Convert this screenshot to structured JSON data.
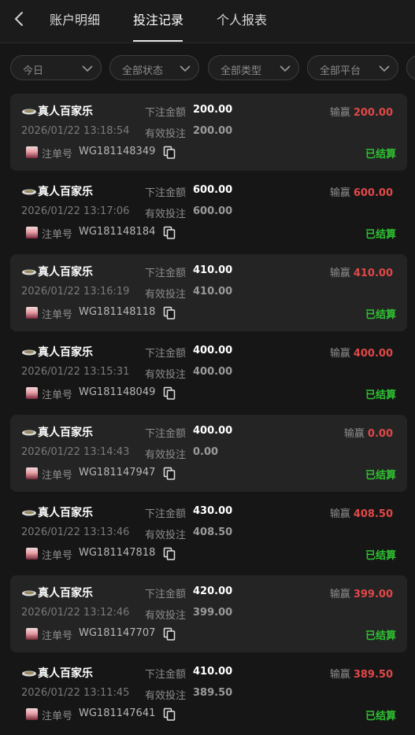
{
  "header": {
    "tabs": [
      {
        "label": "账户明细",
        "active": false
      },
      {
        "label": "投注记录",
        "active": true
      },
      {
        "label": "个人报表",
        "active": false
      }
    ]
  },
  "filters": [
    {
      "label": "今日"
    },
    {
      "label": "全部状态"
    },
    {
      "label": "全部类型"
    },
    {
      "label": "全部平台"
    }
  ],
  "labels": {
    "bet_amount": "下注金额",
    "valid_bet": "有效投注",
    "win_loss": "输赢",
    "order_no": "注单号"
  },
  "colors": {
    "win": "#e04848",
    "status": "#2fc032"
  },
  "records": [
    {
      "game": "真人百家乐",
      "bet": "200.00",
      "valid": "200.00",
      "winloss": "200.00",
      "time": "2026/01/22 13:18:54",
      "order": "WG181148349",
      "status": "已结算"
    },
    {
      "game": "真人百家乐",
      "bet": "600.00",
      "valid": "600.00",
      "winloss": "600.00",
      "time": "2026/01/22 13:17:06",
      "order": "WG181148184",
      "status": "已结算"
    },
    {
      "game": "真人百家乐",
      "bet": "410.00",
      "valid": "410.00",
      "winloss": "410.00",
      "time": "2026/01/22 13:16:19",
      "order": "WG181148118",
      "status": "已结算"
    },
    {
      "game": "真人百家乐",
      "bet": "400.00",
      "valid": "400.00",
      "winloss": "400.00",
      "time": "2026/01/22 13:15:31",
      "order": "WG181148049",
      "status": "已结算"
    },
    {
      "game": "真人百家乐",
      "bet": "400.00",
      "valid": "0.00",
      "winloss": "0.00",
      "time": "2026/01/22 13:14:43",
      "order": "WG181147947",
      "status": "已结算"
    },
    {
      "game": "真人百家乐",
      "bet": "430.00",
      "valid": "408.50",
      "winloss": "408.50",
      "time": "2026/01/22 13:13:46",
      "order": "WG181147818",
      "status": "已结算"
    },
    {
      "game": "真人百家乐",
      "bet": "420.00",
      "valid": "399.00",
      "winloss": "399.00",
      "time": "2026/01/22 13:12:46",
      "order": "WG181147707",
      "status": "已结算"
    },
    {
      "game": "真人百家乐",
      "bet": "410.00",
      "valid": "389.50",
      "winloss": "389.50",
      "time": "2026/01/22 13:11:45",
      "order": "WG181147641",
      "status": "已结算"
    }
  ]
}
